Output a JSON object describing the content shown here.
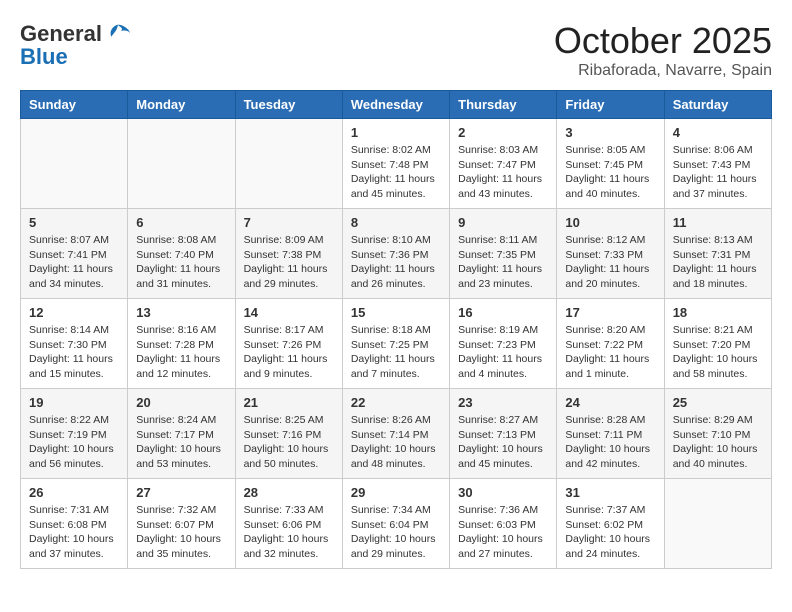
{
  "header": {
    "logo_line1": "General",
    "logo_line2": "Blue",
    "month_title": "October 2025",
    "subtitle": "Ribaforada, Navarre, Spain"
  },
  "days_of_week": [
    "Sunday",
    "Monday",
    "Tuesday",
    "Wednesday",
    "Thursday",
    "Friday",
    "Saturday"
  ],
  "weeks": [
    [
      {
        "day": "",
        "detail": ""
      },
      {
        "day": "",
        "detail": ""
      },
      {
        "day": "",
        "detail": ""
      },
      {
        "day": "1",
        "detail": "Sunrise: 8:02 AM\nSunset: 7:48 PM\nDaylight: 11 hours\nand 45 minutes."
      },
      {
        "day": "2",
        "detail": "Sunrise: 8:03 AM\nSunset: 7:47 PM\nDaylight: 11 hours\nand 43 minutes."
      },
      {
        "day": "3",
        "detail": "Sunrise: 8:05 AM\nSunset: 7:45 PM\nDaylight: 11 hours\nand 40 minutes."
      },
      {
        "day": "4",
        "detail": "Sunrise: 8:06 AM\nSunset: 7:43 PM\nDaylight: 11 hours\nand 37 minutes."
      }
    ],
    [
      {
        "day": "5",
        "detail": "Sunrise: 8:07 AM\nSunset: 7:41 PM\nDaylight: 11 hours\nand 34 minutes."
      },
      {
        "day": "6",
        "detail": "Sunrise: 8:08 AM\nSunset: 7:40 PM\nDaylight: 11 hours\nand 31 minutes."
      },
      {
        "day": "7",
        "detail": "Sunrise: 8:09 AM\nSunset: 7:38 PM\nDaylight: 11 hours\nand 29 minutes."
      },
      {
        "day": "8",
        "detail": "Sunrise: 8:10 AM\nSunset: 7:36 PM\nDaylight: 11 hours\nand 26 minutes."
      },
      {
        "day": "9",
        "detail": "Sunrise: 8:11 AM\nSunset: 7:35 PM\nDaylight: 11 hours\nand 23 minutes."
      },
      {
        "day": "10",
        "detail": "Sunrise: 8:12 AM\nSunset: 7:33 PM\nDaylight: 11 hours\nand 20 minutes."
      },
      {
        "day": "11",
        "detail": "Sunrise: 8:13 AM\nSunset: 7:31 PM\nDaylight: 11 hours\nand 18 minutes."
      }
    ],
    [
      {
        "day": "12",
        "detail": "Sunrise: 8:14 AM\nSunset: 7:30 PM\nDaylight: 11 hours\nand 15 minutes."
      },
      {
        "day": "13",
        "detail": "Sunrise: 8:16 AM\nSunset: 7:28 PM\nDaylight: 11 hours\nand 12 minutes."
      },
      {
        "day": "14",
        "detail": "Sunrise: 8:17 AM\nSunset: 7:26 PM\nDaylight: 11 hours\nand 9 minutes."
      },
      {
        "day": "15",
        "detail": "Sunrise: 8:18 AM\nSunset: 7:25 PM\nDaylight: 11 hours\nand 7 minutes."
      },
      {
        "day": "16",
        "detail": "Sunrise: 8:19 AM\nSunset: 7:23 PM\nDaylight: 11 hours\nand 4 minutes."
      },
      {
        "day": "17",
        "detail": "Sunrise: 8:20 AM\nSunset: 7:22 PM\nDaylight: 11 hours\nand 1 minute."
      },
      {
        "day": "18",
        "detail": "Sunrise: 8:21 AM\nSunset: 7:20 PM\nDaylight: 10 hours\nand 58 minutes."
      }
    ],
    [
      {
        "day": "19",
        "detail": "Sunrise: 8:22 AM\nSunset: 7:19 PM\nDaylight: 10 hours\nand 56 minutes."
      },
      {
        "day": "20",
        "detail": "Sunrise: 8:24 AM\nSunset: 7:17 PM\nDaylight: 10 hours\nand 53 minutes."
      },
      {
        "day": "21",
        "detail": "Sunrise: 8:25 AM\nSunset: 7:16 PM\nDaylight: 10 hours\nand 50 minutes."
      },
      {
        "day": "22",
        "detail": "Sunrise: 8:26 AM\nSunset: 7:14 PM\nDaylight: 10 hours\nand 48 minutes."
      },
      {
        "day": "23",
        "detail": "Sunrise: 8:27 AM\nSunset: 7:13 PM\nDaylight: 10 hours\nand 45 minutes."
      },
      {
        "day": "24",
        "detail": "Sunrise: 8:28 AM\nSunset: 7:11 PM\nDaylight: 10 hours\nand 42 minutes."
      },
      {
        "day": "25",
        "detail": "Sunrise: 8:29 AM\nSunset: 7:10 PM\nDaylight: 10 hours\nand 40 minutes."
      }
    ],
    [
      {
        "day": "26",
        "detail": "Sunrise: 7:31 AM\nSunset: 6:08 PM\nDaylight: 10 hours\nand 37 minutes."
      },
      {
        "day": "27",
        "detail": "Sunrise: 7:32 AM\nSunset: 6:07 PM\nDaylight: 10 hours\nand 35 minutes."
      },
      {
        "day": "28",
        "detail": "Sunrise: 7:33 AM\nSunset: 6:06 PM\nDaylight: 10 hours\nand 32 minutes."
      },
      {
        "day": "29",
        "detail": "Sunrise: 7:34 AM\nSunset: 6:04 PM\nDaylight: 10 hours\nand 29 minutes."
      },
      {
        "day": "30",
        "detail": "Sunrise: 7:36 AM\nSunset: 6:03 PM\nDaylight: 10 hours\nand 27 minutes."
      },
      {
        "day": "31",
        "detail": "Sunrise: 7:37 AM\nSunset: 6:02 PM\nDaylight: 10 hours\nand 24 minutes."
      },
      {
        "day": "",
        "detail": ""
      }
    ]
  ]
}
